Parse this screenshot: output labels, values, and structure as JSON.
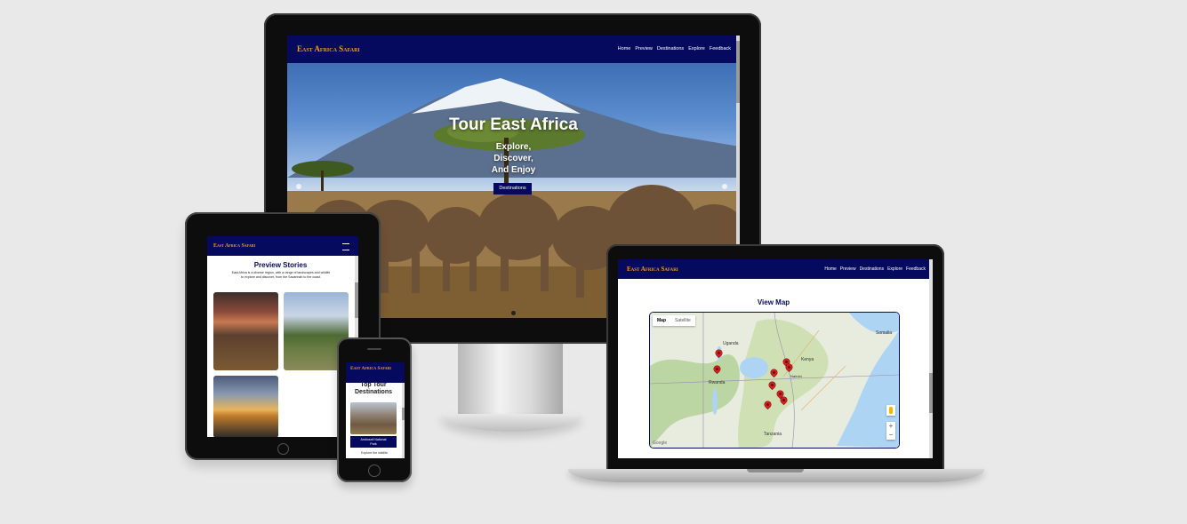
{
  "desktop": {
    "brand": "East Africa Safari",
    "nav": [
      "Home",
      "Preview",
      "Destinations",
      "Explore",
      "Feedback"
    ],
    "hero_title": "Tour East Africa",
    "hero_lines": [
      "Explore,",
      "Discover,",
      "And Enjoy"
    ],
    "hero_button": "Destinations"
  },
  "tablet": {
    "brand": "East Africa Safari",
    "section_title": "Preview Stories",
    "intro": [
      "East Africa is a diverse region, with a range of landscapes and wildlife",
      "to explore and discover, from the Savannah to the coast."
    ]
  },
  "laptop": {
    "brand": "East Africa Safari",
    "nav": [
      "Home",
      "Preview",
      "Destinations",
      "Explore",
      "Feedback"
    ],
    "map_title": "View Map",
    "map_tabs": [
      "Map",
      "Satellite"
    ],
    "map_labels": [
      "Uganda",
      "Kenya",
      "Rwanda",
      "Tanzania",
      "Somalia",
      "Nairobi"
    ],
    "zoom_in": "+",
    "zoom_out": "−",
    "google_mark": "Google",
    "pin_count": 9
  },
  "phone": {
    "brand": "East Africa Safari",
    "heading": [
      "Top Tour",
      "Destinations"
    ],
    "card_caption": [
      "Amboseli National",
      "Park"
    ],
    "footer_text": "Explore the wildlife"
  }
}
